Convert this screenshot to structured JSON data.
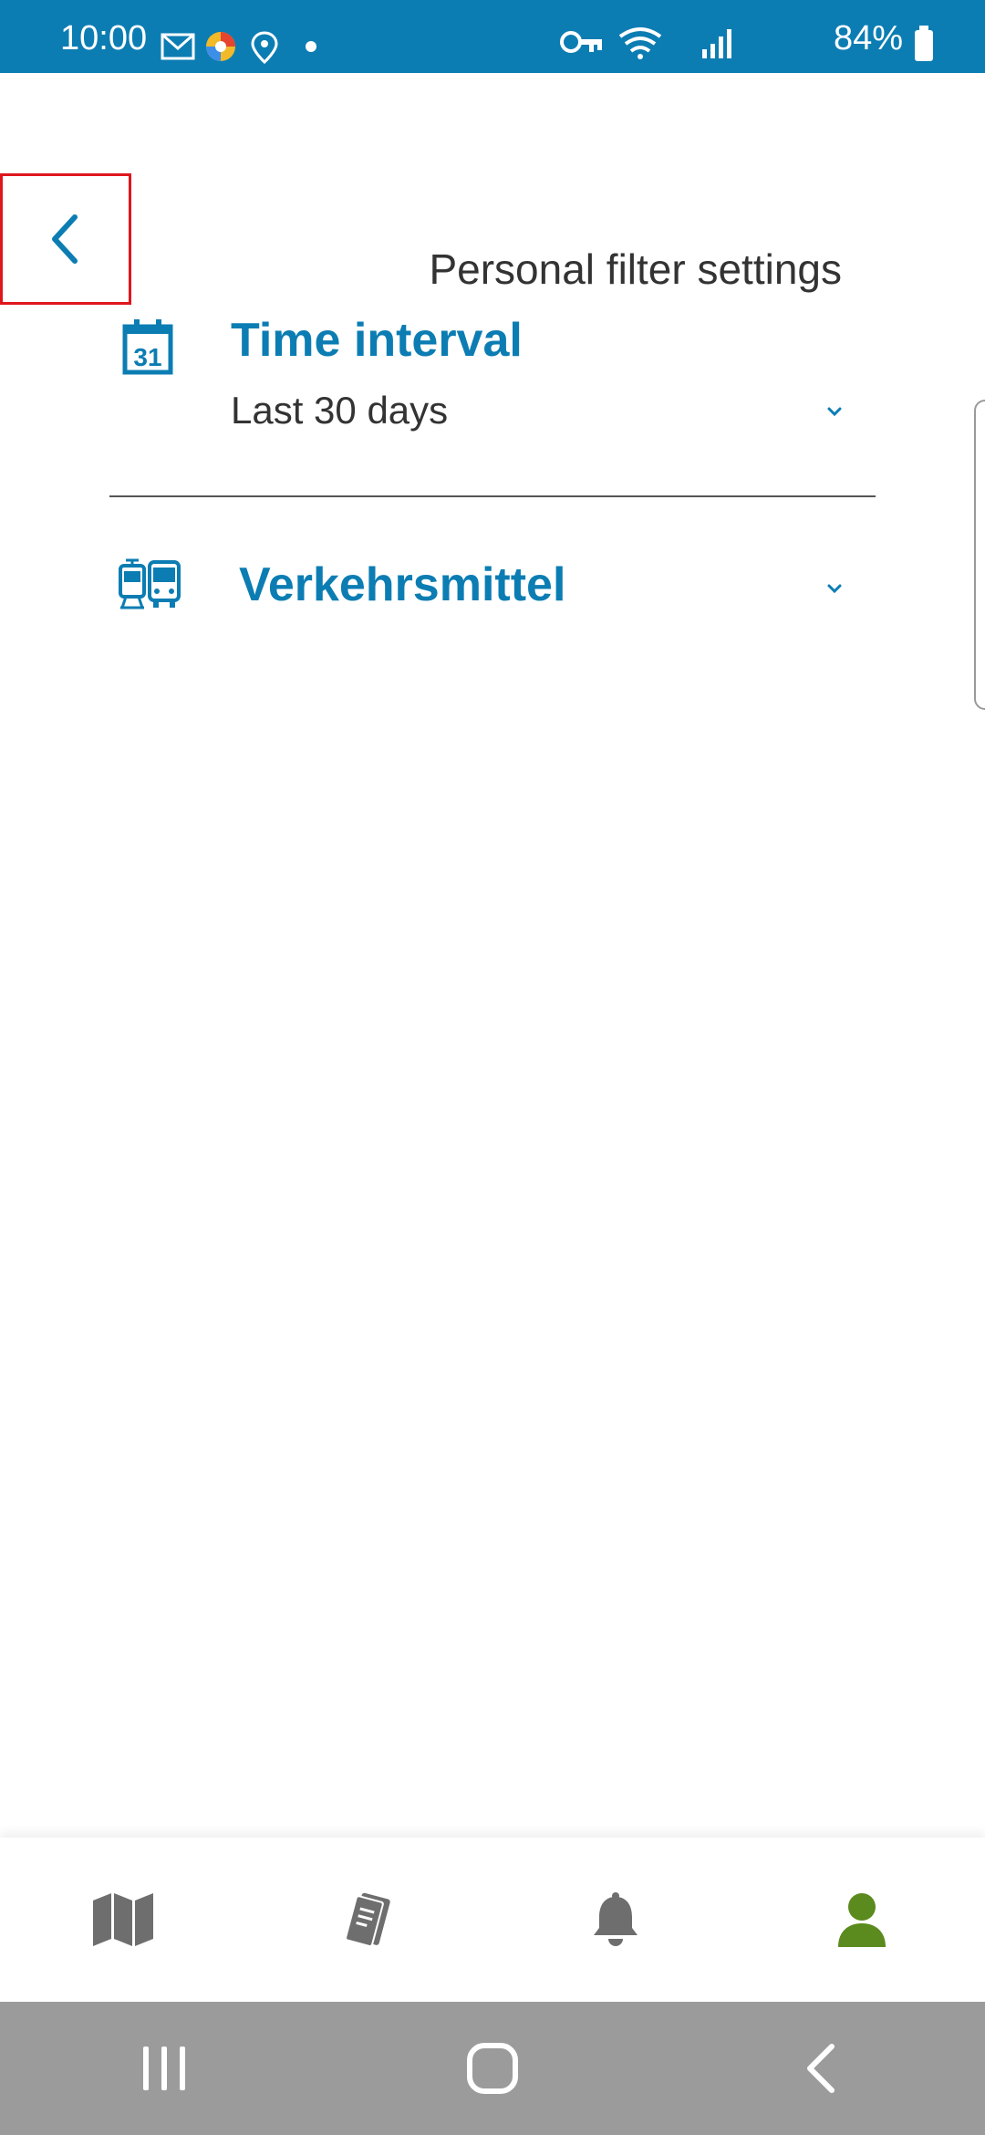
{
  "status_bar": {
    "time": "10:00",
    "battery": "84%",
    "color": "#0c7db3"
  },
  "header": {
    "back_icon": "chevron-left-icon",
    "title": "Personal filter settings"
  },
  "filters": {
    "time_interval": {
      "title": "Time interval",
      "value": "Last 30 days",
      "icon": "calendar-icon",
      "calendar_day": "31"
    },
    "transport": {
      "title": "Verkehrsmittel",
      "icon": "tram-bus-icon"
    }
  },
  "tab_bar": {
    "items": [
      {
        "icon": "map-icon",
        "active": false
      },
      {
        "icon": "tickets-icon",
        "active": false
      },
      {
        "icon": "bell-icon",
        "active": false
      },
      {
        "icon": "profile-icon",
        "active": true
      }
    ],
    "active_color": "#5b8a1e",
    "inactive_color": "#6e6e6e"
  },
  "system_nav": {
    "items": [
      "recent-apps-icon",
      "home-icon",
      "back-icon"
    ]
  },
  "accent_color": "#0c7db3"
}
